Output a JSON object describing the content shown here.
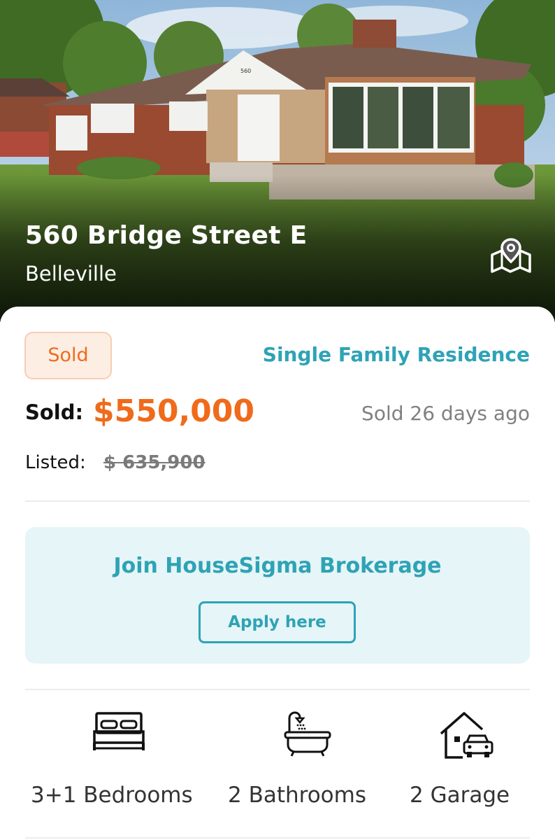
{
  "listing": {
    "address": "560 Bridge Street E",
    "city": "Belleville",
    "house_number_sign": "560",
    "status_badge": "Sold",
    "property_type": "Single Family Residence",
    "sold_label": "Sold:",
    "sold_price": "$550,000",
    "sold_ago": "Sold 26 days ago",
    "listed_label": "Listed:",
    "listed_price": "$ 635,900"
  },
  "promo": {
    "title": "Join HouseSigma Brokerage",
    "button_label": "Apply here"
  },
  "features": [
    {
      "icon": "bed-icon",
      "label": "3+1 Bedrooms"
    },
    {
      "icon": "bathtub-icon",
      "label": "2 Bathrooms"
    },
    {
      "icon": "garage-icon",
      "label": "2 Garage"
    }
  ],
  "colors": {
    "accent_orange": "#ef6b1b",
    "accent_teal": "#2ea3b5",
    "promo_bg": "#e6f5f7",
    "badge_bg": "#fdeee4"
  }
}
